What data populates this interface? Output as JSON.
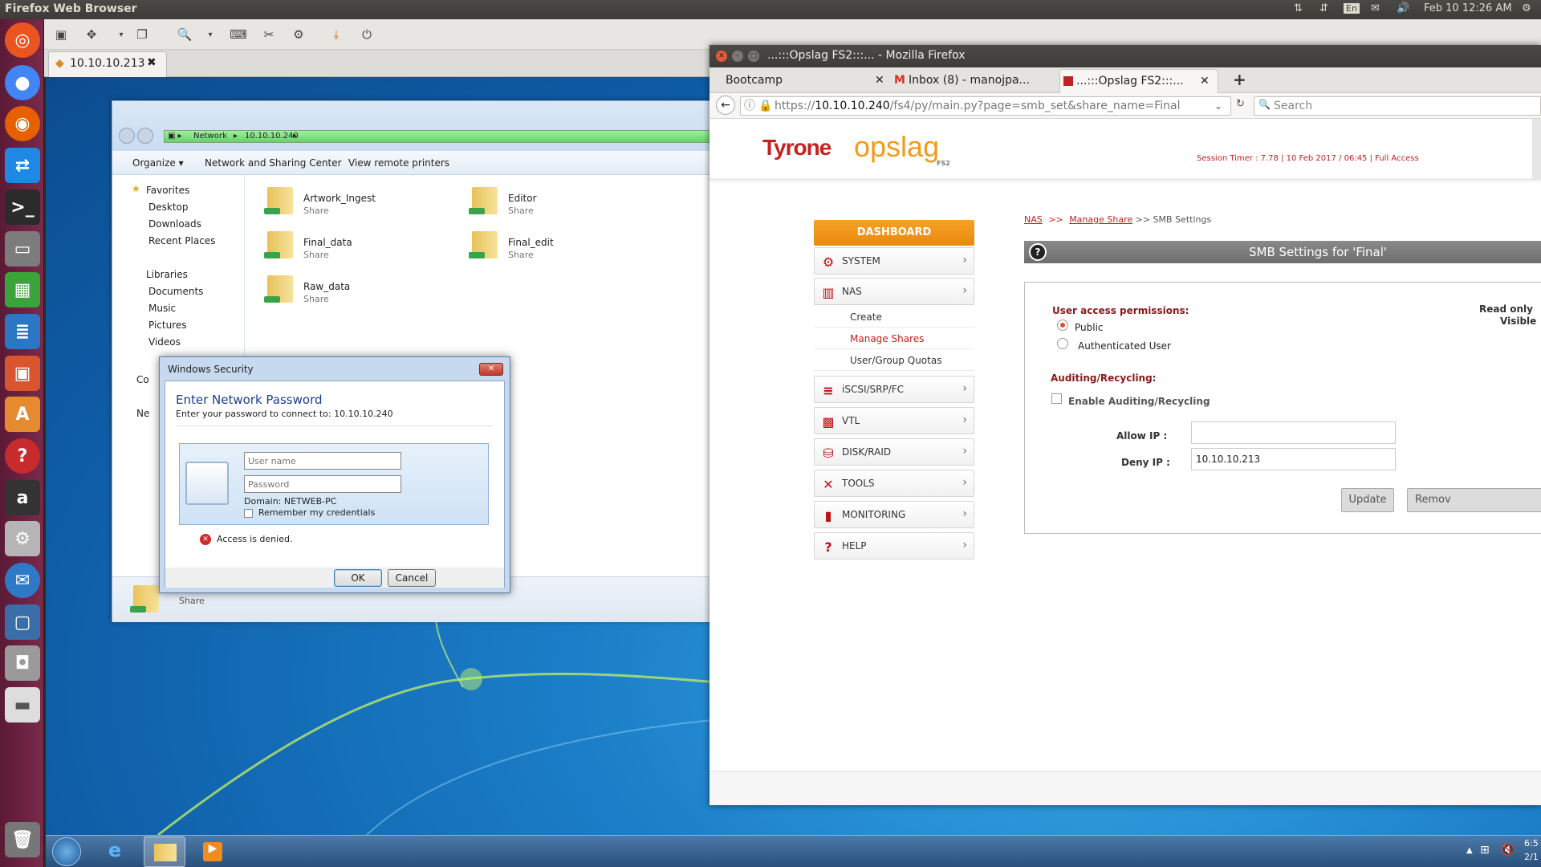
{
  "ubuntu": {
    "app_title": "Firefox Web Browser",
    "keyboard": "En",
    "clock": "Feb 10 12:26 AM"
  },
  "vm": {
    "tab_label": "10.10.10.213"
  },
  "explorer": {
    "breadcrumb": [
      "Network",
      "10.10.10.240"
    ],
    "commands": [
      "Organize ▾",
      "Network and Sharing Center",
      "View remote printers"
    ],
    "nav": {
      "favorites_title": "Favorites",
      "favorites": [
        "Desktop",
        "Downloads",
        "Recent Places"
      ],
      "libraries_title": "Libraries",
      "libraries": [
        "Documents",
        "Music",
        "Pictures",
        "Videos"
      ],
      "computer_partial": "Co",
      "network_partial": "Ne"
    },
    "folders": [
      {
        "name": "Artwork_Ingest",
        "type": "Share"
      },
      {
        "name": "Editor",
        "type": "Share"
      },
      {
        "name": "Final_data",
        "type": "Share"
      },
      {
        "name": "Final_edit",
        "type": "Share"
      },
      {
        "name": "Raw_data",
        "type": "Share"
      }
    ],
    "details_type": "Share"
  },
  "winsec": {
    "title": "Windows Security",
    "heading": "Enter Network Password",
    "subheading": "Enter your password to connect to: 10.10.10.240",
    "username_placeholder": "User name",
    "password_placeholder": "Password",
    "domain": "Domain: NETWEB-PC",
    "remember": "Remember my credentials",
    "error": "Access is denied.",
    "ok": "OK",
    "cancel": "Cancel"
  },
  "firefox": {
    "window_title": "...:::Opslag FS2:::... - Mozilla Firefox",
    "tabs": [
      "Bootcamp",
      "Inbox (8) - manojpa...",
      "...:::Opslag FS2:::..."
    ],
    "url_prefix": "https://",
    "url_host": "10.10.10.240",
    "url_path": "/fs4/py/main.py?page=smb_set&share_name=Final",
    "search_placeholder": "Search"
  },
  "opslag": {
    "brand_tyrone": "Tyrone",
    "brand_opslag": "opslag",
    "brand_fs": "FS2",
    "session": "Session Timer : 7.78 | 10 Feb 2017 / 06:45 | Full Access",
    "dashboard": "DASHBOARD",
    "menu": [
      {
        "label": "SYSTEM",
        "icon": "gear-icon"
      },
      {
        "label": "NAS",
        "icon": "nas-icon"
      },
      {
        "label": "iSCSI/SRP/FC",
        "icon": "server-icon"
      },
      {
        "label": "VTL",
        "icon": "tape-icon"
      },
      {
        "label": "DISK/RAID",
        "icon": "disk-icon"
      },
      {
        "label": "TOOLS",
        "icon": "tools-icon"
      },
      {
        "label": "MONITORING",
        "icon": "chart-icon"
      },
      {
        "label": "HELP",
        "icon": "help-icon"
      }
    ],
    "nas_sub": [
      "Create",
      "Manage Shares",
      "User/Group Quotas"
    ],
    "breadcrumb": [
      "NAS",
      ">>",
      "Manage Share",
      ">> SMB Settings"
    ],
    "panel_title": "SMB Settings for 'Final'",
    "user_access_label": "User access permissions:",
    "option_public": "Public",
    "option_auth": "Authenticated User",
    "readonly": "Read only",
    "visible": "Visible",
    "auditing_label": "Auditing/Recycling:",
    "enable_auditing": "Enable Auditing/Recycling",
    "allow_ip_label": "Allow IP :",
    "allow_ip_value": "",
    "deny_ip_label": "Deny IP :",
    "deny_ip_value": "10.10.10.213",
    "update": "Update",
    "remove": "Remov"
  },
  "wintask": {
    "clock_time": "6:5",
    "clock_date": "2/1"
  }
}
